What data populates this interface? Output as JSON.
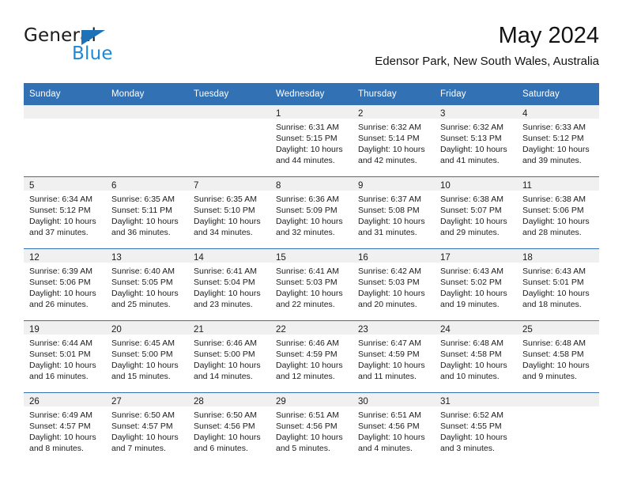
{
  "brand": {
    "name_top": "General",
    "name_bottom": "Blue",
    "triangle_color": "#1e72b8",
    "blue_text_color": "#1e88d8"
  },
  "header": {
    "title": "May 2024",
    "subtitle": "Edensor Park, New South Wales, Australia"
  },
  "theme": {
    "header_bg": "#3272b4",
    "header_text": "#ffffff",
    "daynum_band_bg": "#f0f0f0",
    "cell_divider": "#3272b4",
    "page_bg": "#ffffff",
    "text": "#1c1c1c"
  },
  "weekday_headers": [
    "Sunday",
    "Monday",
    "Tuesday",
    "Wednesday",
    "Thursday",
    "Friday",
    "Saturday"
  ],
  "labels": {
    "sunrise_prefix": "Sunrise:",
    "sunset_prefix": "Sunset:",
    "daylight_prefix": "Daylight:"
  },
  "weeks": [
    [
      {
        "day": "",
        "lines": [
          "",
          "",
          "",
          ""
        ]
      },
      {
        "day": "",
        "lines": [
          "",
          "",
          "",
          ""
        ]
      },
      {
        "day": "",
        "lines": [
          "",
          "",
          "",
          ""
        ]
      },
      {
        "day": "1",
        "lines": [
          "Sunrise: 6:31 AM",
          "Sunset: 5:15 PM",
          "Daylight: 10 hours",
          "and 44 minutes."
        ]
      },
      {
        "day": "2",
        "lines": [
          "Sunrise: 6:32 AM",
          "Sunset: 5:14 PM",
          "Daylight: 10 hours",
          "and 42 minutes."
        ]
      },
      {
        "day": "3",
        "lines": [
          "Sunrise: 6:32 AM",
          "Sunset: 5:13 PM",
          "Daylight: 10 hours",
          "and 41 minutes."
        ]
      },
      {
        "day": "4",
        "lines": [
          "Sunrise: 6:33 AM",
          "Sunset: 5:12 PM",
          "Daylight: 10 hours",
          "and 39 minutes."
        ]
      }
    ],
    [
      {
        "day": "5",
        "lines": [
          "Sunrise: 6:34 AM",
          "Sunset: 5:12 PM",
          "Daylight: 10 hours",
          "and 37 minutes."
        ]
      },
      {
        "day": "6",
        "lines": [
          "Sunrise: 6:35 AM",
          "Sunset: 5:11 PM",
          "Daylight: 10 hours",
          "and 36 minutes."
        ]
      },
      {
        "day": "7",
        "lines": [
          "Sunrise: 6:35 AM",
          "Sunset: 5:10 PM",
          "Daylight: 10 hours",
          "and 34 minutes."
        ]
      },
      {
        "day": "8",
        "lines": [
          "Sunrise: 6:36 AM",
          "Sunset: 5:09 PM",
          "Daylight: 10 hours",
          "and 32 minutes."
        ]
      },
      {
        "day": "9",
        "lines": [
          "Sunrise: 6:37 AM",
          "Sunset: 5:08 PM",
          "Daylight: 10 hours",
          "and 31 minutes."
        ]
      },
      {
        "day": "10",
        "lines": [
          "Sunrise: 6:38 AM",
          "Sunset: 5:07 PM",
          "Daylight: 10 hours",
          "and 29 minutes."
        ]
      },
      {
        "day": "11",
        "lines": [
          "Sunrise: 6:38 AM",
          "Sunset: 5:06 PM",
          "Daylight: 10 hours",
          "and 28 minutes."
        ]
      }
    ],
    [
      {
        "day": "12",
        "lines": [
          "Sunrise: 6:39 AM",
          "Sunset: 5:06 PM",
          "Daylight: 10 hours",
          "and 26 minutes."
        ]
      },
      {
        "day": "13",
        "lines": [
          "Sunrise: 6:40 AM",
          "Sunset: 5:05 PM",
          "Daylight: 10 hours",
          "and 25 minutes."
        ]
      },
      {
        "day": "14",
        "lines": [
          "Sunrise: 6:41 AM",
          "Sunset: 5:04 PM",
          "Daylight: 10 hours",
          "and 23 minutes."
        ]
      },
      {
        "day": "15",
        "lines": [
          "Sunrise: 6:41 AM",
          "Sunset: 5:03 PM",
          "Daylight: 10 hours",
          "and 22 minutes."
        ]
      },
      {
        "day": "16",
        "lines": [
          "Sunrise: 6:42 AM",
          "Sunset: 5:03 PM",
          "Daylight: 10 hours",
          "and 20 minutes."
        ]
      },
      {
        "day": "17",
        "lines": [
          "Sunrise: 6:43 AM",
          "Sunset: 5:02 PM",
          "Daylight: 10 hours",
          "and 19 minutes."
        ]
      },
      {
        "day": "18",
        "lines": [
          "Sunrise: 6:43 AM",
          "Sunset: 5:01 PM",
          "Daylight: 10 hours",
          "and 18 minutes."
        ]
      }
    ],
    [
      {
        "day": "19",
        "lines": [
          "Sunrise: 6:44 AM",
          "Sunset: 5:01 PM",
          "Daylight: 10 hours",
          "and 16 minutes."
        ]
      },
      {
        "day": "20",
        "lines": [
          "Sunrise: 6:45 AM",
          "Sunset: 5:00 PM",
          "Daylight: 10 hours",
          "and 15 minutes."
        ]
      },
      {
        "day": "21",
        "lines": [
          "Sunrise: 6:46 AM",
          "Sunset: 5:00 PM",
          "Daylight: 10 hours",
          "and 14 minutes."
        ]
      },
      {
        "day": "22",
        "lines": [
          "Sunrise: 6:46 AM",
          "Sunset: 4:59 PM",
          "Daylight: 10 hours",
          "and 12 minutes."
        ]
      },
      {
        "day": "23",
        "lines": [
          "Sunrise: 6:47 AM",
          "Sunset: 4:59 PM",
          "Daylight: 10 hours",
          "and 11 minutes."
        ]
      },
      {
        "day": "24",
        "lines": [
          "Sunrise: 6:48 AM",
          "Sunset: 4:58 PM",
          "Daylight: 10 hours",
          "and 10 minutes."
        ]
      },
      {
        "day": "25",
        "lines": [
          "Sunrise: 6:48 AM",
          "Sunset: 4:58 PM",
          "Daylight: 10 hours",
          "and 9 minutes."
        ]
      }
    ],
    [
      {
        "day": "26",
        "lines": [
          "Sunrise: 6:49 AM",
          "Sunset: 4:57 PM",
          "Daylight: 10 hours",
          "and 8 minutes."
        ]
      },
      {
        "day": "27",
        "lines": [
          "Sunrise: 6:50 AM",
          "Sunset: 4:57 PM",
          "Daylight: 10 hours",
          "and 7 minutes."
        ]
      },
      {
        "day": "28",
        "lines": [
          "Sunrise: 6:50 AM",
          "Sunset: 4:56 PM",
          "Daylight: 10 hours",
          "and 6 minutes."
        ]
      },
      {
        "day": "29",
        "lines": [
          "Sunrise: 6:51 AM",
          "Sunset: 4:56 PM",
          "Daylight: 10 hours",
          "and 5 minutes."
        ]
      },
      {
        "day": "30",
        "lines": [
          "Sunrise: 6:51 AM",
          "Sunset: 4:56 PM",
          "Daylight: 10 hours",
          "and 4 minutes."
        ]
      },
      {
        "day": "31",
        "lines": [
          "Sunrise: 6:52 AM",
          "Sunset: 4:55 PM",
          "Daylight: 10 hours",
          "and 3 minutes."
        ]
      },
      {
        "day": "",
        "lines": [
          "",
          "",
          "",
          ""
        ]
      }
    ]
  ]
}
